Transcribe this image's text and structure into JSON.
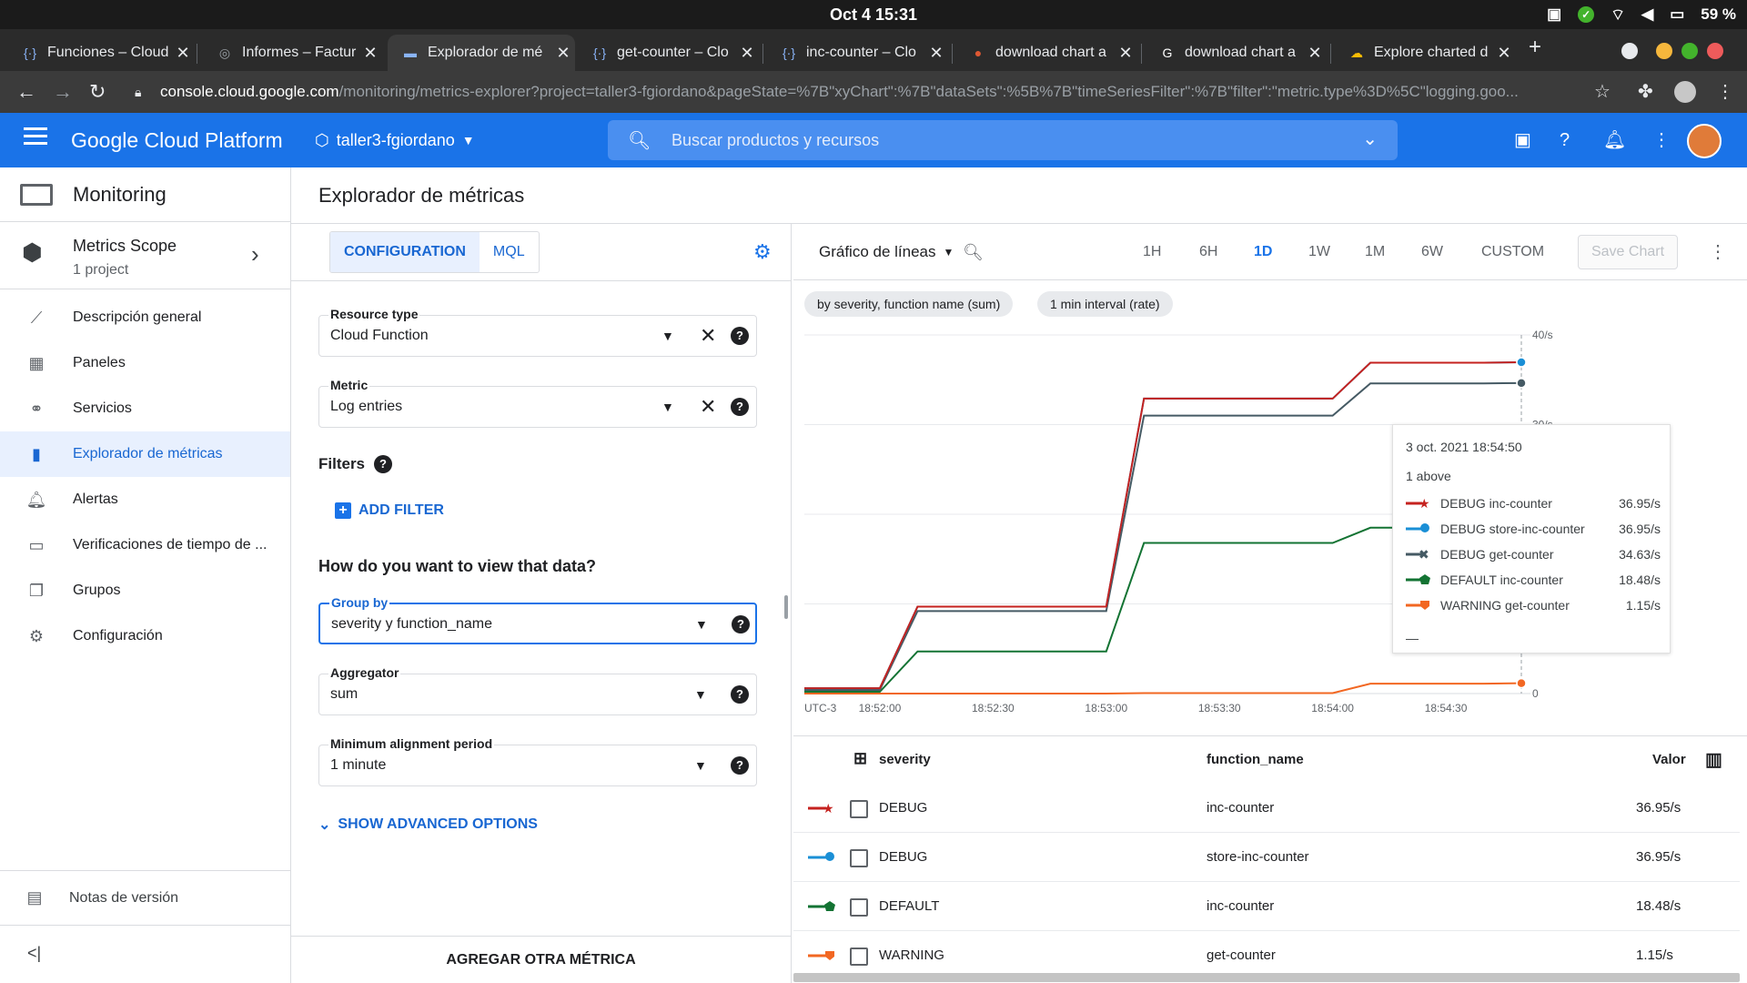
{
  "os": {
    "clock": "Oct 4  15:31",
    "battery": "59 %"
  },
  "tabs": [
    {
      "title": "Funciones – Cloud",
      "favicon": "code-brackets-icon"
    },
    {
      "title": "Informes – Factur",
      "favicon": "globe-icon"
    },
    {
      "title": "Explorador de mé",
      "favicon": "monitoring-icon"
    },
    {
      "title": "get-counter – Clo",
      "favicon": "code-brackets-icon"
    },
    {
      "title": "inc-counter – Clo",
      "favicon": "code-brackets-icon"
    },
    {
      "title": "download chart a",
      "favicon": "duckduckgo-icon"
    },
    {
      "title": "download chart a",
      "favicon": "google-icon"
    },
    {
      "title": "Explore charted d",
      "favicon": "gcp-icon"
    }
  ],
  "address": {
    "host": "console.cloud.google.com",
    "path": "/monitoring/metrics-explorer?project=taller3-fgiordano&pageState=%7B\"xyChart\":%7B\"dataSets\":%5B%7B\"timeSeriesFilter\":%7B\"filter\":\"metric.type%3D%5C\"logging.goo..."
  },
  "gcp": {
    "brand": "Google Cloud Platform",
    "project": "taller3-fgiordano",
    "search_placeholder": "Buscar productos y recursos"
  },
  "nav": {
    "product": "Monitoring",
    "scope_title": "Metrics Scope",
    "scope_sub": "1 project",
    "items": [
      {
        "label": "Descripción general",
        "icon": "overview-icon"
      },
      {
        "label": "Paneles",
        "icon": "dashboard-icon"
      },
      {
        "label": "Servicios",
        "icon": "services-icon"
      },
      {
        "label": "Explorador de métricas",
        "icon": "bar-chart-icon"
      },
      {
        "label": "Alertas",
        "icon": "bell-icon"
      },
      {
        "label": "Verificaciones de tiempo de ...",
        "icon": "uptime-icon"
      },
      {
        "label": "Grupos",
        "icon": "groups-icon"
      },
      {
        "label": "Configuración",
        "icon": "gear-icon"
      }
    ],
    "notes": "Notas de versión"
  },
  "page": {
    "title": "Explorador de métricas"
  },
  "config": {
    "tab_config": "CONFIGURATION",
    "tab_mql": "MQL",
    "resource_label": "Resource type",
    "resource_value": "Cloud Function",
    "metric_label": "Metric",
    "metric_value": "Log entries",
    "filters_label": "Filters",
    "add_filter": "ADD FILTER",
    "question": "How do you want to view that data?",
    "groupby_label": "Group by",
    "groupby_value": "severity y function_name",
    "aggregator_label": "Aggregator",
    "aggregator_value": "sum",
    "period_label": "Minimum alignment period",
    "period_value": "1 minute",
    "advanced": "SHOW ADVANCED OPTIONS",
    "add_metric": "AGREGAR OTRA MÉTRICA"
  },
  "chart_toolbar": {
    "chart_type": "Gráfico de líneas",
    "ranges": [
      "1H",
      "6H",
      "1D",
      "1W",
      "1M",
      "6W",
      "CUSTOM"
    ],
    "selected_range": "1D",
    "save": "Save Chart",
    "chips": [
      "by severity, function name (sum)",
      "1 min interval (rate)"
    ]
  },
  "chart_data": {
    "type": "line",
    "timezone_label": "UTC-3",
    "x": [
      "18:51:40",
      "18:51:50",
      "18:52:00",
      "18:52:10",
      "18:52:20",
      "18:52:30",
      "18:52:40",
      "18:52:50",
      "18:53:00",
      "18:53:10",
      "18:53:20",
      "18:53:30",
      "18:53:40",
      "18:53:50",
      "18:54:00",
      "18:54:10",
      "18:54:20",
      "18:54:30",
      "18:54:40",
      "18:54:50"
    ],
    "x_ticks": [
      "18:52:00",
      "18:52:30",
      "18:53:00",
      "18:53:30",
      "18:54:00",
      "18:54:30"
    ],
    "y_ticks": [
      "0",
      "10/s",
      "20/s",
      "30/s",
      "40/s"
    ],
    "ylim": [
      0,
      40
    ],
    "series": [
      {
        "name": "DEBUG inc-counter",
        "color": "#c5221f",
        "values": [
          0.6,
          0.6,
          0.6,
          9.7,
          9.7,
          9.7,
          9.7,
          9.7,
          9.7,
          32.9,
          32.9,
          32.9,
          32.9,
          32.9,
          32.9,
          36.9,
          36.9,
          36.9,
          36.9,
          36.95
        ]
      },
      {
        "name": "DEBUG store-inc-counter",
        "color": "#1a8fd6",
        "values": [
          0.6,
          0.6,
          0.6,
          9.7,
          9.7,
          9.7,
          9.7,
          9.7,
          9.7,
          32.9,
          32.9,
          32.9,
          32.9,
          32.9,
          32.9,
          36.9,
          36.9,
          36.9,
          36.9,
          36.95
        ]
      },
      {
        "name": "DEBUG get-counter",
        "color": "#455a64",
        "values": [
          0.4,
          0.4,
          0.4,
          9.2,
          9.2,
          9.2,
          9.2,
          9.2,
          9.2,
          31.0,
          31.0,
          31.0,
          31.0,
          31.0,
          31.0,
          34.6,
          34.6,
          34.6,
          34.6,
          34.63
        ]
      },
      {
        "name": "DEFAULT inc-counter",
        "color": "#137333",
        "values": [
          0.2,
          0.2,
          0.2,
          4.7,
          4.7,
          4.7,
          4.7,
          4.7,
          4.7,
          16.8,
          16.8,
          16.8,
          16.8,
          16.8,
          16.8,
          18.5,
          18.5,
          18.5,
          18.5,
          18.48
        ]
      },
      {
        "name": "WARNING get-counter",
        "color": "#f26722",
        "values": [
          0.0,
          0.0,
          0.0,
          0.0,
          0.0,
          0.0,
          0.0,
          0.0,
          0.0,
          0.05,
          0.05,
          0.05,
          0.05,
          0.05,
          0.05,
          1.1,
          1.1,
          1.1,
          1.1,
          1.15
        ]
      }
    ]
  },
  "tooltip": {
    "date": "3 oct. 2021 18:54:50",
    "above": "1 above",
    "rows": [
      {
        "name": "DEBUG inc-counter",
        "value": "36.95/s"
      },
      {
        "name": "DEBUG store-inc-counter",
        "value": "36.95/s"
      },
      {
        "name": "DEBUG get-counter",
        "value": "34.63/s"
      },
      {
        "name": "DEFAULT inc-counter",
        "value": "18.48/s"
      },
      {
        "name": "WARNING get-counter",
        "value": "1.15/s"
      }
    ],
    "dash": "—"
  },
  "table": {
    "headers": {
      "severity": "severity",
      "function": "function_name",
      "value": "Valor"
    },
    "rows": [
      {
        "severity": "DEBUG",
        "function": "inc-counter",
        "value": "36.95/s",
        "color": "#c5221f"
      },
      {
        "severity": "DEBUG",
        "function": "store-inc-counter",
        "value": "36.95/s",
        "color": "#1a8fd6"
      },
      {
        "severity": "DEFAULT",
        "function": "inc-counter",
        "value": "18.48/s",
        "color": "#137333"
      },
      {
        "severity": "WARNING",
        "function": "get-counter",
        "value": "1.15/s",
        "color": "#f26722"
      }
    ]
  }
}
